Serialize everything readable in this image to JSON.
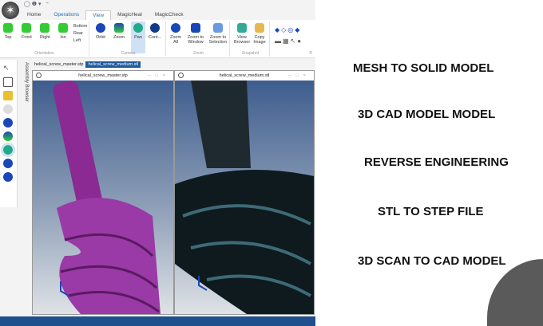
{
  "tabs": [
    "Home",
    "Operations",
    "View",
    "MagicHeal",
    "MagicCheck"
  ],
  "ribbon": {
    "orientation": {
      "label": "Orientation",
      "buttons": [
        "Top",
        "Front",
        "Right",
        "Iso"
      ],
      "small": [
        "Bottom",
        "Rear",
        "Left"
      ]
    },
    "camera": {
      "label": "Camera",
      "buttons": [
        "Orbit",
        "Zoom",
        "Pan",
        "Cont..."
      ]
    },
    "zoom": {
      "label": "Zoom",
      "buttons": [
        "Zoom All",
        "Zoom to Window",
        "Zoom to Selection"
      ]
    },
    "snapshot": {
      "label": "Snapshot",
      "buttons": [
        "View Browser",
        "Copy Image"
      ]
    },
    "render": {
      "label": "R"
    }
  },
  "assembly_browser": "Assembly Browser",
  "doc_tabs": [
    "helical_screw_master.stp",
    "helical_screw_medium.stl"
  ],
  "viewports": [
    {
      "title": "helical_screw_master.stp"
    },
    {
      "title": "helical_screw_medium.stl"
    }
  ],
  "services": [
    "MESH TO SOLID MODEL",
    "3D CAD MODEL MODEL",
    "REVERSE ENGINEERING",
    "STL TO STEP FILE",
    "3D SCAN TO CAD MODEL"
  ]
}
